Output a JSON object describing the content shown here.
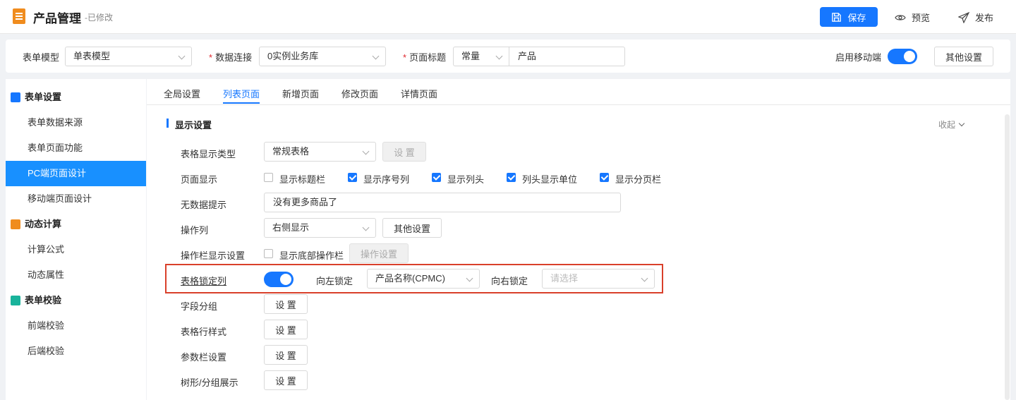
{
  "header": {
    "title": "产品管理",
    "status": "-已修改",
    "save_label": "保存",
    "preview_label": "预览",
    "publish_label": "发布"
  },
  "config": {
    "form_model_label": "表单模型",
    "form_model_value": "单表模型",
    "data_conn_label": "数据连接",
    "data_conn_value": "0实例业务库",
    "page_title_label": "页面标题",
    "page_title_type": "常量",
    "page_title_value": "产品",
    "mobile_label": "启用移动端",
    "mobile_enabled": true,
    "other_settings_label": "其他设置"
  },
  "sidebar": {
    "groups": [
      {
        "label": "表单设置",
        "icon": "form-settings-icon",
        "items": [
          "表单数据来源",
          "表单页面功能",
          "PC端页面设计",
          "移动端页面设计"
        ]
      },
      {
        "label": "动态计算",
        "icon": "dynamic-calc-icon",
        "items": [
          "计算公式",
          "动态属性"
        ]
      },
      {
        "label": "表单校验",
        "icon": "form-validate-icon",
        "items": [
          "前端校验",
          "后端校验"
        ]
      }
    ],
    "active_item": "PC端页面设计"
  },
  "tabs": [
    "全局设置",
    "列表页面",
    "新增页面",
    "修改页面",
    "详情页面"
  ],
  "active_tab": "列表页面",
  "section": {
    "title": "显示设置",
    "collapse_label": "收起"
  },
  "rows": {
    "table_type": {
      "label": "表格显示类型",
      "value": "常规表格",
      "button": "设 置"
    },
    "page_display": {
      "label": "页面显示",
      "options": [
        {
          "label": "显示标题栏",
          "checked": false
        },
        {
          "label": "显示序号列",
          "checked": true
        },
        {
          "label": "显示列头",
          "checked": true
        },
        {
          "label": "列头显示单位",
          "checked": true
        },
        {
          "label": "显示分页栏",
          "checked": true
        }
      ]
    },
    "no_data": {
      "label": "无数据提示",
      "value": "没有更多商品了"
    },
    "action_col": {
      "label": "操作列",
      "value": "右侧显示",
      "button": "其他设置"
    },
    "action_bar": {
      "label": "操作栏显示设置",
      "checkbox_label": "显示底部操作栏",
      "checked": false,
      "button": "操作设置"
    },
    "lock_col": {
      "label": "表格锁定列",
      "enabled": true,
      "left_label": "向左锁定",
      "left_value": "产品名称(CPMC)",
      "right_label": "向右锁定",
      "right_placeholder": "请选择"
    },
    "field_group": {
      "label": "字段分组",
      "button": "设 置"
    },
    "row_style": {
      "label": "表格行样式",
      "button": "设 置"
    },
    "param_bar": {
      "label": "参数栏设置",
      "button": "设 置"
    },
    "tree_group": {
      "label": "树形/分组展示",
      "button": "设 置"
    }
  },
  "colors": {
    "primary": "#1677ff",
    "highlight": "#d9402b",
    "required": "#e0282e"
  }
}
